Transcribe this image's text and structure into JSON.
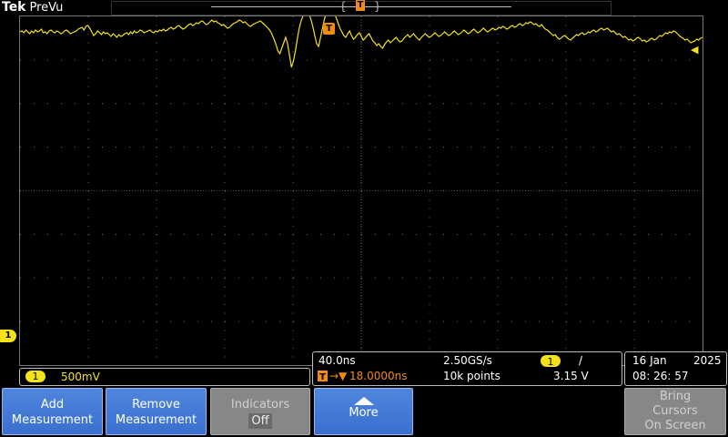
{
  "header": {
    "brand": "Tek",
    "status": "PreVu"
  },
  "colors": {
    "ch1": "#f4e21a",
    "trigger": "#f28c0f",
    "grid": "#6e6e6e",
    "button": "#3a6fd0"
  },
  "markers": {
    "trigger_pos": "T",
    "ch1_ground": "1",
    "trigger_level_icon": "arrow-left"
  },
  "channel_readout": {
    "badge": "1",
    "scale": "500mV"
  },
  "timebase": {
    "scale": "40.0ns",
    "sample_rate": "2.50GS/s",
    "trigger_source": "1",
    "trigger_slope": "/",
    "delay_icon": "T",
    "delay_arrow": "→▼",
    "delay": "18.0000ns",
    "record_length": "10k points",
    "trigger_level": "3.15 V"
  },
  "datetime": {
    "day_month": "16 Jan",
    "year": "2025",
    "time": "08: 26: 57"
  },
  "softkeys": {
    "add": {
      "line1": "Add",
      "line2": "Measurement"
    },
    "remove": {
      "line1": "Remove",
      "line2": "Measurement"
    },
    "indicators": {
      "line1": "Indicators",
      "value": "Off"
    },
    "more": {
      "label": "More"
    },
    "bring_cursors": {
      "line1": "Bring",
      "line2": "Cursors",
      "line3": "On Screen"
    }
  },
  "waveform_y": [
    34,
    33,
    35,
    32,
    34,
    36,
    33,
    35,
    32,
    34,
    33,
    31,
    35,
    34,
    36,
    33,
    32,
    34,
    35,
    33,
    34,
    36,
    35,
    33,
    32,
    34,
    36,
    35,
    34,
    33,
    31,
    30,
    29,
    32,
    28,
    27,
    30,
    34,
    38,
    36,
    33,
    35,
    37,
    34,
    36,
    35,
    37,
    39,
    36,
    38,
    40,
    37,
    39,
    38,
    36,
    35,
    37,
    34,
    36,
    33,
    35,
    34,
    32,
    33,
    35,
    34,
    33,
    32,
    34,
    35,
    33,
    34,
    32,
    33,
    31,
    33,
    32,
    30,
    29,
    31,
    30,
    28,
    27,
    29,
    31,
    30,
    28,
    26,
    25,
    27,
    26,
    24,
    25,
    23,
    22,
    24,
    26,
    25,
    23,
    21,
    23,
    22,
    24,
    25,
    27,
    26,
    28,
    30,
    29,
    27,
    25,
    24,
    23,
    21,
    22,
    24,
    23,
    25,
    27,
    28,
    26,
    25,
    24,
    23,
    22,
    24,
    26,
    28,
    30,
    33,
    37,
    42,
    48,
    55,
    58,
    52,
    46,
    40,
    47,
    60,
    73,
    66,
    55,
    42,
    30,
    22,
    16,
    12,
    10,
    14,
    20,
    28,
    38,
    47,
    50,
    40,
    30,
    20,
    14,
    10,
    8,
    12,
    14,
    18,
    24,
    30,
    34,
    38,
    40,
    36,
    33,
    38,
    42,
    40,
    37,
    35,
    39,
    43,
    41,
    38,
    36,
    40,
    44,
    46,
    49,
    47,
    50,
    52,
    48,
    45,
    43,
    46,
    44,
    42,
    40,
    43,
    45,
    44,
    41,
    39,
    37,
    40,
    38,
    36,
    39,
    41,
    43,
    40,
    38,
    36,
    38,
    40,
    39,
    37,
    35,
    37,
    39,
    38,
    36,
    34,
    36,
    38,
    37,
    35,
    33,
    35,
    37,
    36,
    34,
    32,
    34,
    36,
    35,
    33,
    31,
    33,
    35,
    34,
    32,
    30,
    32,
    34,
    33,
    31,
    30,
    32,
    31,
    29,
    30,
    28,
    29,
    31,
    30,
    28,
    27,
    29,
    28,
    26,
    25,
    27,
    26,
    24,
    25,
    23,
    24,
    26,
    25,
    27,
    28,
    26,
    29,
    31,
    32,
    34,
    36,
    38,
    37,
    40,
    42,
    41,
    39,
    38,
    40,
    42,
    43,
    41,
    39,
    37,
    38,
    36,
    35,
    37,
    36,
    34,
    35,
    33,
    32,
    34,
    33,
    31,
    30,
    32,
    31,
    30,
    32,
    34,
    33,
    35,
    37,
    36,
    38,
    40,
    39,
    41,
    43,
    42,
    44,
    43,
    41,
    40,
    42,
    44,
    43,
    45,
    44,
    42,
    41,
    43,
    42,
    40,
    38,
    39,
    37,
    35,
    36,
    34,
    35,
    33,
    34,
    36,
    38,
    40,
    41,
    43,
    42,
    44,
    46,
    45,
    44,
    42,
    43,
    41,
    40
  ]
}
